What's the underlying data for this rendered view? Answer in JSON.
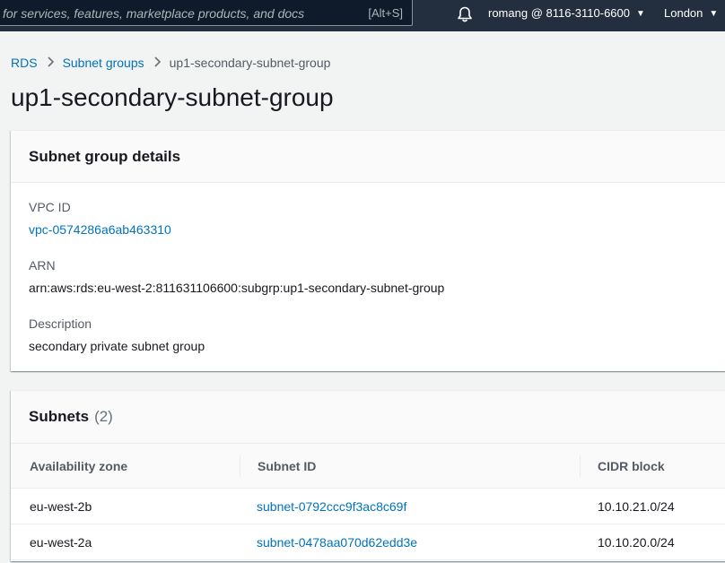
{
  "topnav": {
    "search_placeholder": "for services, features, marketplace products, and docs",
    "search_shortcut": "[Alt+S]",
    "account": "romang @ 8116-3110-6600",
    "region": "London"
  },
  "breadcrumb": {
    "items": [
      "RDS",
      "Subnet groups"
    ],
    "current": "up1-secondary-subnet-group"
  },
  "page_title": "up1-secondary-subnet-group",
  "details": {
    "title": "Subnet group details",
    "vpc_label": "VPC ID",
    "vpc_value": "vpc-0574286a6ab463310",
    "arn_label": "ARN",
    "arn_value": "arn:aws:rds:eu-west-2:811631106600:subgrp:up1-secondary-subnet-group",
    "desc_label": "Description",
    "desc_value": "secondary private subnet group"
  },
  "subnets": {
    "title": "Subnets",
    "count": "(2)",
    "columns": [
      "Availability zone",
      "Subnet ID",
      "CIDR block"
    ],
    "rows": [
      {
        "az": "eu-west-2b",
        "subnet_id": "subnet-0792ccc9f3ac8c69f",
        "cidr": "10.10.21.0/24"
      },
      {
        "az": "eu-west-2a",
        "subnet_id": "subnet-0478aa070d62edd3e",
        "cidr": "10.10.20.0/24"
      }
    ]
  },
  "colors": {
    "nav_bg": "#232f3e",
    "link": "#0073bb",
    "page_bg": "#f2f3f3"
  },
  "icons": [
    "bell-icon",
    "caret-down-icon",
    "chevron-right-icon"
  ]
}
